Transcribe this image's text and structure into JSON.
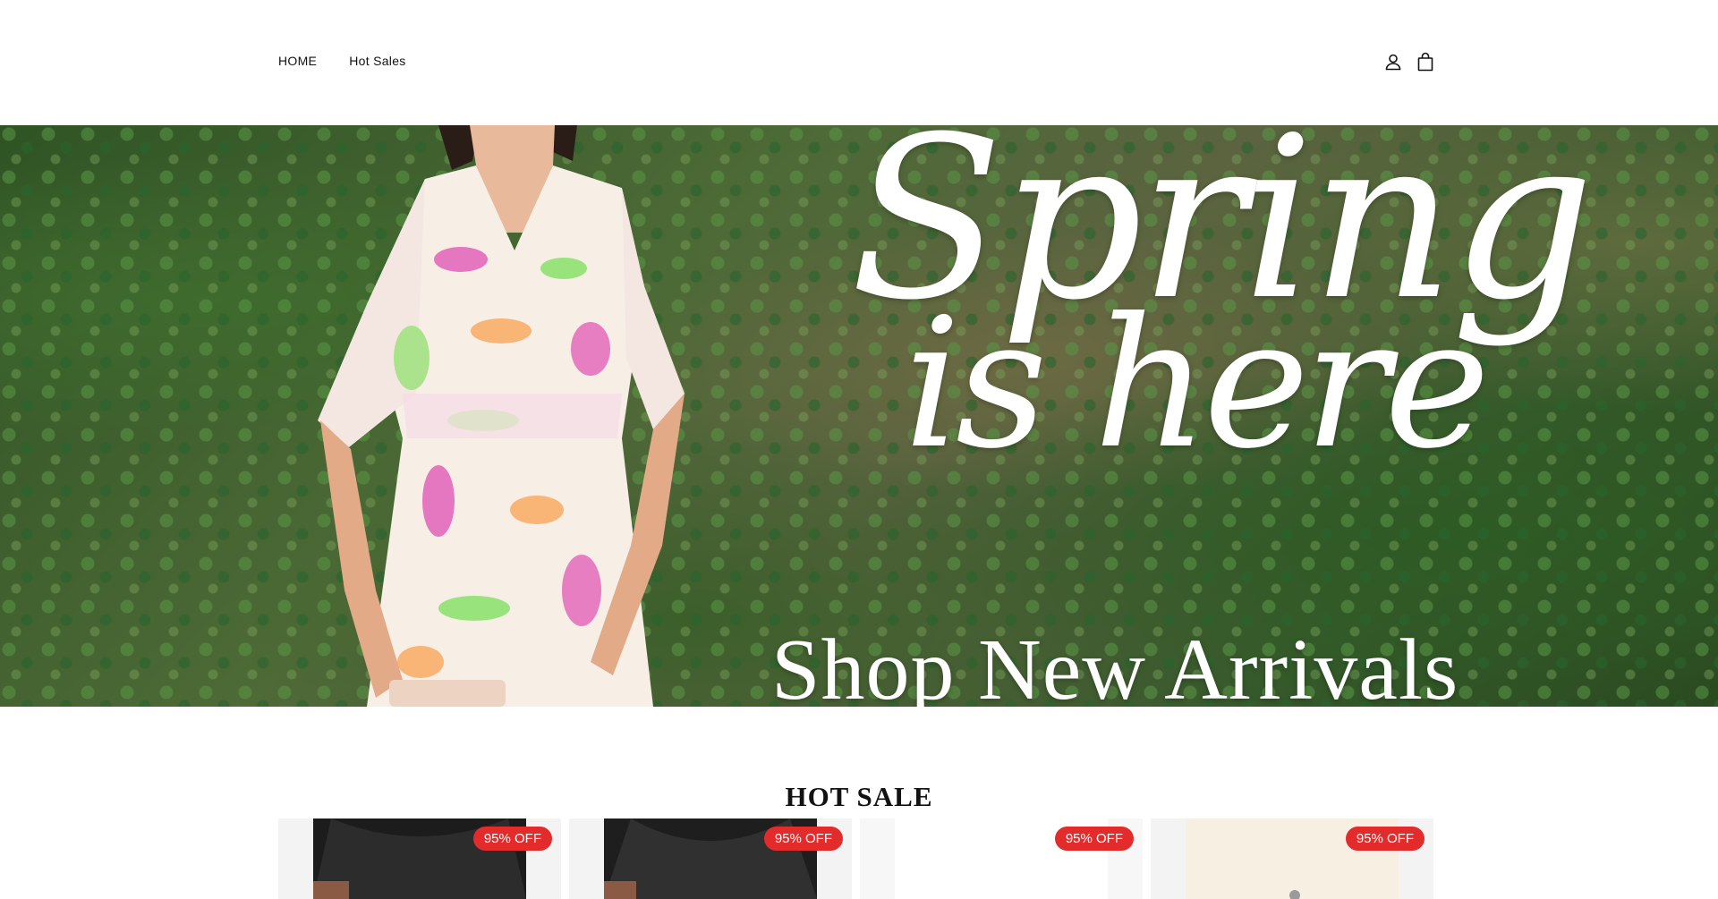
{
  "nav": {
    "items": [
      {
        "label": "HOME"
      },
      {
        "label": "Hot Sales"
      }
    ]
  },
  "header_icons": [
    "account-icon",
    "cart-icon"
  ],
  "hero": {
    "script_line1": "Spring",
    "script_line2": "is here",
    "cta": "Shop New Arrivals"
  },
  "section": {
    "title": "HOT SALE"
  },
  "products": [
    {
      "badge": "95% OFF"
    },
    {
      "badge": "95% OFF"
    },
    {
      "badge": "95% OFF"
    },
    {
      "badge": "95% OFF"
    }
  ],
  "colors": {
    "badge": "#e32b2b",
    "text": "#121212",
    "background": "#ffffff"
  }
}
